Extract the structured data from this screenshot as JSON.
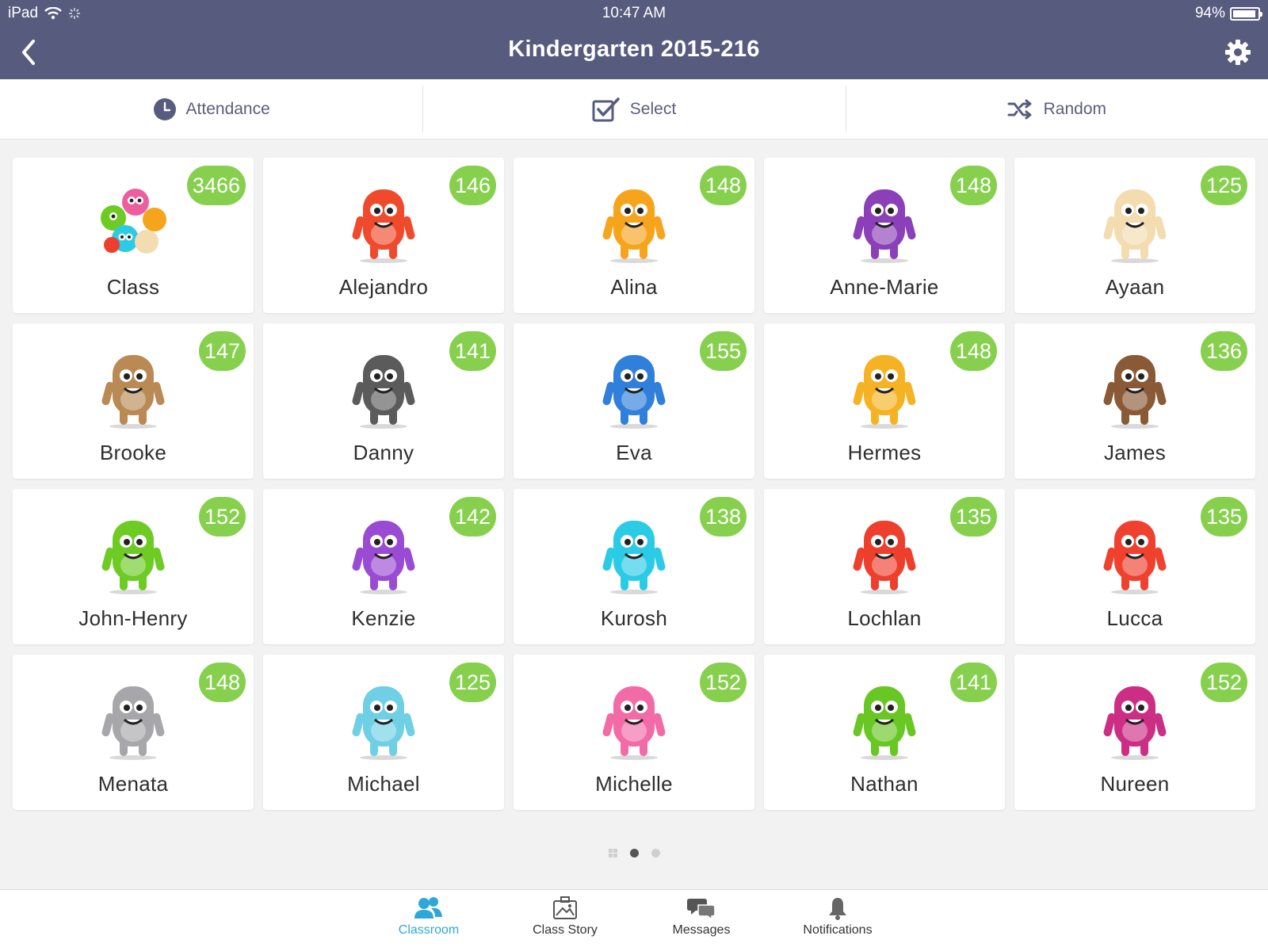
{
  "status": {
    "device": "iPad",
    "time": "10:47 AM",
    "battery": "94%",
    "battery_level": 0.94
  },
  "header": {
    "title": "Kindergarten 2015-216"
  },
  "toolbar": {
    "attendance": "Attendance",
    "select": "Select",
    "random": "Random"
  },
  "students": [
    {
      "name": "Class",
      "points": "3466",
      "color": "#ec5f9e"
    },
    {
      "name": "Alejandro",
      "points": "146",
      "color": "#f04a2d"
    },
    {
      "name": "Alina",
      "points": "148",
      "color": "#f7a41d"
    },
    {
      "name": "Anne-Marie",
      "points": "148",
      "color": "#8b3fb8"
    },
    {
      "name": "Ayaan",
      "points": "125",
      "color": "#f2dcb0"
    },
    {
      "name": "Brooke",
      "points": "147",
      "color": "#b98a53"
    },
    {
      "name": "Danny",
      "points": "141",
      "color": "#5b5b5b"
    },
    {
      "name": "Eva",
      "points": "155",
      "color": "#2f7fdb"
    },
    {
      "name": "Hermes",
      "points": "148",
      "color": "#f5b323"
    },
    {
      "name": "James",
      "points": "136",
      "color": "#8a5a36"
    },
    {
      "name": "John-Henry",
      "points": "152",
      "color": "#6dcb24"
    },
    {
      "name": "Kenzie",
      "points": "142",
      "color": "#9a4bd3"
    },
    {
      "name": "Kurosh",
      "points": "138",
      "color": "#2bcbe6"
    },
    {
      "name": "Lochlan",
      "points": "135",
      "color": "#ee3f2d"
    },
    {
      "name": "Lucca",
      "points": "135",
      "color": "#f0402e"
    },
    {
      "name": "Menata",
      "points": "148",
      "color": "#a7a7ab"
    },
    {
      "name": "Michael",
      "points": "125",
      "color": "#6fcfe4"
    },
    {
      "name": "Michelle",
      "points": "152",
      "color": "#f26aa6"
    },
    {
      "name": "Nathan",
      "points": "141",
      "color": "#68c722"
    },
    {
      "name": "Nureen",
      "points": "152",
      "color": "#cc2e84"
    }
  ],
  "pagination": {
    "pages": 2,
    "current": 1
  },
  "bottom_nav": [
    {
      "label": "Classroom",
      "icon": "users-icon",
      "active": true
    },
    {
      "label": "Class Story",
      "icon": "photo-icon",
      "active": false
    },
    {
      "label": "Messages",
      "icon": "chat-icon",
      "active": false
    },
    {
      "label": "Notifications",
      "icon": "bell-icon",
      "active": false
    }
  ],
  "colors": {
    "header": "#575c7e",
    "badge": "#86d04e",
    "active_tab": "#2ea8d8"
  }
}
